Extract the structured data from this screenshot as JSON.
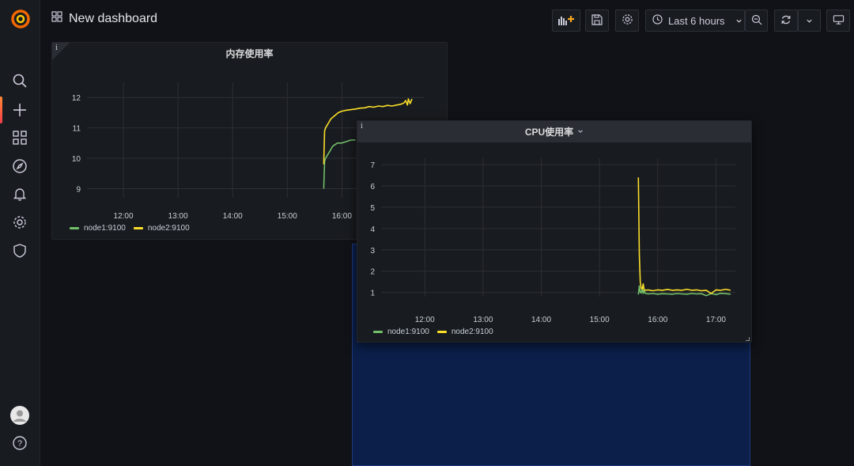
{
  "header": {
    "title": "New dashboard",
    "time_range": "Last 6 hours"
  },
  "sidebar": {
    "items": [
      "search-icon",
      "plus-icon",
      "dashboards-icon",
      "explore-icon",
      "alerting-icon",
      "configuration-icon",
      "shield-icon"
    ],
    "bottom": [
      "avatar",
      "help-icon"
    ]
  },
  "colors": {
    "node1": "#73bf69",
    "node2": "#fade2a",
    "drop_zone": "#0b1f4a"
  },
  "panels": [
    {
      "title": "内存使用率",
      "legend": [
        {
          "name": "node1:9100",
          "color": "#73bf69"
        },
        {
          "name": "node2:9100",
          "color": "#fade2a"
        }
      ]
    },
    {
      "title": "CPU使用率",
      "legend": [
        {
          "name": "node1:9100",
          "color": "#73bf69"
        },
        {
          "name": "node2:9100",
          "color": "#fade2a"
        }
      ]
    }
  ],
  "chart_data": [
    {
      "type": "line",
      "title": "内存使用率",
      "x_ticks": [
        "12:00",
        "13:00",
        "14:00",
        "15:00",
        "16:00"
      ],
      "y_ticks": [
        9,
        10,
        11,
        12
      ],
      "ylim": [
        8.7,
        12.5
      ],
      "xlim": [
        "11:20",
        "17:30"
      ],
      "grid": true,
      "legend_position": "bottom-left",
      "series": [
        {
          "name": "node1:9100",
          "color": "#73bf69",
          "x": [
            "15:40",
            "15:41",
            "15:42",
            "15:44",
            "15:46",
            "15:48",
            "15:50",
            "15:55",
            "16:00",
            "16:05",
            "16:10",
            "16:15"
          ],
          "y": [
            9.0,
            9.9,
            10.0,
            10.1,
            10.2,
            10.3,
            10.4,
            10.5,
            10.5,
            10.55,
            10.6,
            10.6
          ]
        },
        {
          "name": "node2:9100",
          "color": "#fade2a",
          "x": [
            "15:40",
            "15:41",
            "15:42",
            "15:44",
            "15:46",
            "15:48",
            "15:52",
            "15:56",
            "16:00",
            "16:05",
            "16:10",
            "16:15",
            "16:20",
            "16:25",
            "16:30",
            "16:35",
            "16:40",
            "16:45",
            "16:50",
            "16:55",
            "17:00",
            "17:05",
            "17:08",
            "17:10",
            "17:12",
            "17:13",
            "17:15",
            "17:17"
          ],
          "y": [
            9.8,
            10.9,
            11.0,
            11.1,
            11.2,
            11.3,
            11.4,
            11.5,
            11.55,
            11.58,
            11.6,
            11.62,
            11.65,
            11.66,
            11.7,
            11.68,
            11.72,
            11.7,
            11.74,
            11.72,
            11.75,
            11.78,
            11.82,
            11.9,
            11.75,
            11.95,
            11.8,
            11.95
          ]
        }
      ]
    },
    {
      "type": "line",
      "title": "CPU使用率",
      "x_ticks": [
        "12:00",
        "13:00",
        "14:00",
        "15:00",
        "16:00",
        "17:00"
      ],
      "y_ticks": [
        1,
        2,
        3,
        4,
        5,
        6,
        7
      ],
      "ylim": [
        0.8,
        7.3
      ],
      "xlim": [
        "11:15",
        "17:20"
      ],
      "grid": true,
      "legend_position": "bottom-left",
      "series": [
        {
          "name": "node1:9100",
          "color": "#73bf69",
          "x": [
            "15:40",
            "15:41",
            "15:42",
            "15:43",
            "15:44",
            "15:45",
            "15:46",
            "15:47",
            "15:48",
            "15:50",
            "15:55",
            "16:00",
            "16:05",
            "16:10",
            "16:15",
            "16:20",
            "16:25",
            "16:30",
            "16:35",
            "16:40",
            "16:45",
            "16:50",
            "16:55",
            "17:00",
            "17:05",
            "17:10",
            "17:15"
          ],
          "y": [
            0.9,
            1.3,
            1.0,
            0.98,
            1.2,
            0.95,
            1.1,
            0.97,
            0.95,
            0.93,
            0.95,
            0.92,
            0.94,
            0.93,
            0.92,
            0.95,
            0.93,
            0.92,
            0.95,
            0.93,
            0.94,
            0.85,
            0.95,
            0.9,
            0.96,
            0.94,
            0.92
          ]
        },
        {
          "name": "node2:9100",
          "color": "#fade2a",
          "x": [
            "15:40",
            "15:41",
            "15:42",
            "15:43",
            "15:44",
            "15:45",
            "15:46",
            "15:48",
            "15:50",
            "15:55",
            "16:00",
            "16:05",
            "16:10",
            "16:15",
            "16:20",
            "16:25",
            "16:30",
            "16:35",
            "16:40",
            "16:45",
            "16:50",
            "16:55",
            "17:00",
            "17:05",
            "17:10",
            "17:15"
          ],
          "y": [
            6.4,
            2.8,
            1.5,
            1.2,
            1.15,
            1.4,
            1.12,
            1.1,
            1.12,
            1.08,
            1.12,
            1.1,
            1.14,
            1.1,
            1.12,
            1.1,
            1.15,
            1.1,
            1.12,
            1.08,
            1.1,
            0.95,
            1.12,
            1.1,
            1.15,
            1.1
          ]
        }
      ]
    }
  ]
}
